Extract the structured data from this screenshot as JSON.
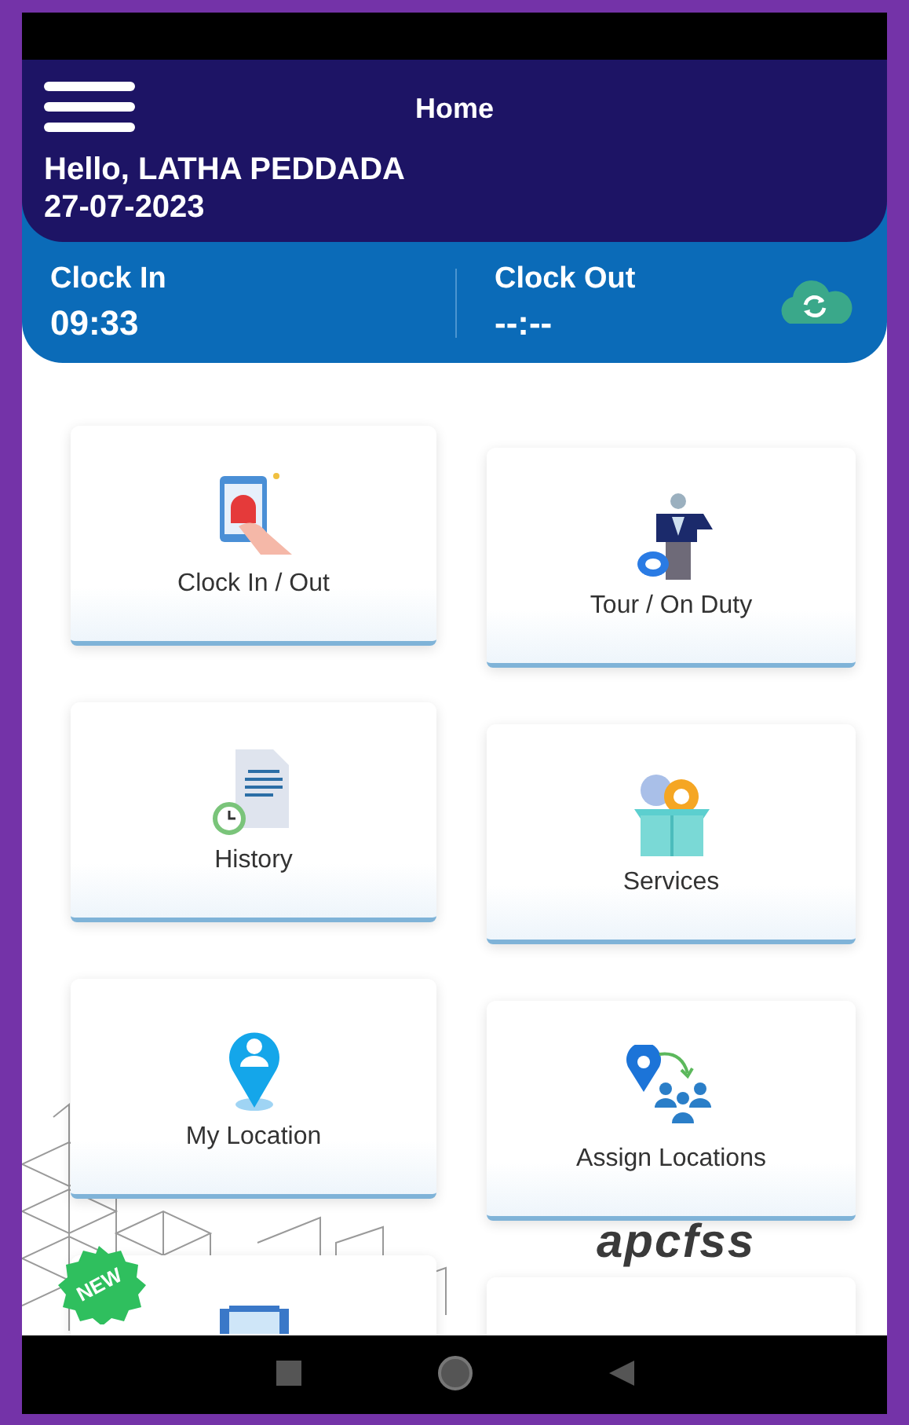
{
  "header": {
    "title": "Home",
    "greeting": "Hello, LATHA PEDDADA",
    "date": "27-07-2023"
  },
  "clock_strip": {
    "clock_in": {
      "label": "Clock In",
      "time": "09:33"
    },
    "clock_out": {
      "label": "Clock Out",
      "time": "--:--"
    }
  },
  "tiles": [
    {
      "kind": "clock",
      "label": "Clock In / Out"
    },
    {
      "kind": "tour",
      "label": "Tour / On Duty"
    },
    {
      "kind": "history",
      "label": "History"
    },
    {
      "kind": "services",
      "label": "Services"
    },
    {
      "kind": "location",
      "label": "My Location"
    },
    {
      "kind": "assign",
      "label": "Assign Locations"
    },
    {
      "kind": "partial",
      "badge": "NEW"
    },
    {
      "kind": "blank"
    }
  ],
  "logo": "apcfss"
}
